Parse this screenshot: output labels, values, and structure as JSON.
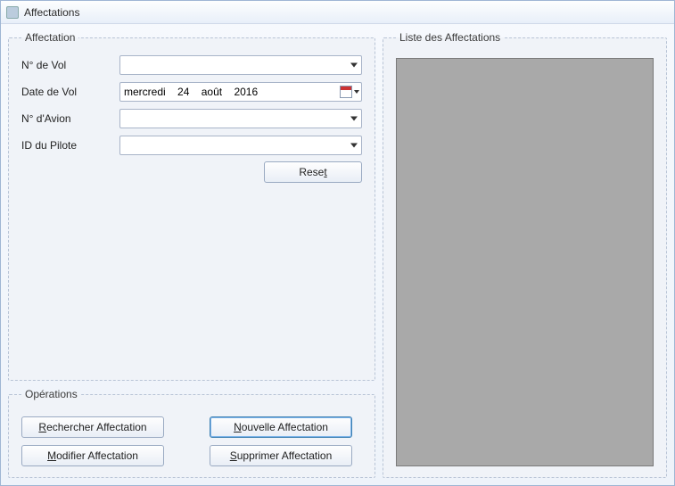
{
  "window": {
    "title": "Affectations"
  },
  "groups": {
    "affectation": "Affectation",
    "operations": "Opérations",
    "liste": "Liste des Affectations"
  },
  "labels": {
    "numVol": "N° de Vol",
    "dateVol": "Date de Vol",
    "numAvion": "N° d'Avion",
    "idPilote": "ID du Pilote"
  },
  "date": {
    "weekday": "mercredi",
    "day": "24",
    "month": "août",
    "year": "2016"
  },
  "buttons": {
    "reset": {
      "mnemonic": "t",
      "before": "Rese",
      "after": ""
    },
    "rechercher": {
      "mnemonic": "R",
      "before": "",
      "after": "echercher Affectation"
    },
    "nouvelle": {
      "mnemonic": "N",
      "before": "",
      "after": "ouvelle Affectation"
    },
    "modifier": {
      "mnemonic": "M",
      "before": "",
      "after": "odifier Affectation"
    },
    "supprimer": {
      "mnemonic": "S",
      "before": "",
      "after": "upprimer Affectation"
    }
  }
}
